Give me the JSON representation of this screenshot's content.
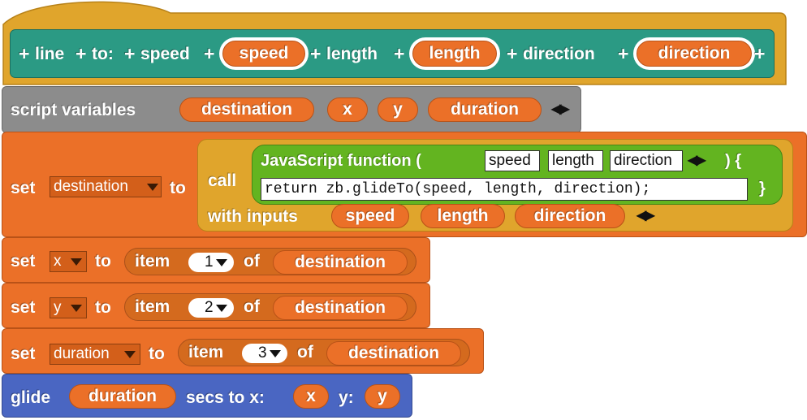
{
  "hat": {
    "plus": "+",
    "word_line": "line",
    "word_to": "to:",
    "word_speed": "speed",
    "param_speed": "speed",
    "word_length": "length",
    "param_length": "length",
    "word_direction": "direction",
    "param_direction": "direction"
  },
  "script_vars": {
    "label": "script variables",
    "vars": [
      "destination",
      "x",
      "y",
      "duration"
    ]
  },
  "set_destination": {
    "set_label": "set",
    "var": "destination",
    "to_label": "to",
    "call_label": "call",
    "js_label": "JavaScript function (",
    "js_close": ") {",
    "params": [
      "speed",
      "length",
      "direction"
    ],
    "code": "return zb.glideTo(speed, length, direction);",
    "brace": "}",
    "with_inputs_label": "with inputs",
    "inputs": [
      "speed",
      "length",
      "direction"
    ]
  },
  "set_rows": [
    {
      "set_label": "set",
      "var": "x",
      "to_label": "to",
      "item_label": "item",
      "index": "1",
      "of_label": "of",
      "list": "destination"
    },
    {
      "set_label": "set",
      "var": "y",
      "to_label": "to",
      "item_label": "item",
      "index": "2",
      "of_label": "of",
      "list": "destination"
    },
    {
      "set_label": "set",
      "var": "duration",
      "to_label": "to",
      "item_label": "item",
      "index": "3",
      "of_label": "of",
      "list": "destination"
    }
  ],
  "glide": {
    "label": "glide",
    "duration": "duration",
    "secs_label": "secs to x:",
    "x": "x",
    "y_label": "y:",
    "y": "y"
  },
  "arrows_glyph": "◀▶",
  "colors": {
    "custom_block": "#e0a52c",
    "hat_prototype": "#2b9a84",
    "variables": "#eb7028",
    "other": "#8c8c8c",
    "operators": "#63b420",
    "motion": "#4a66c2"
  }
}
